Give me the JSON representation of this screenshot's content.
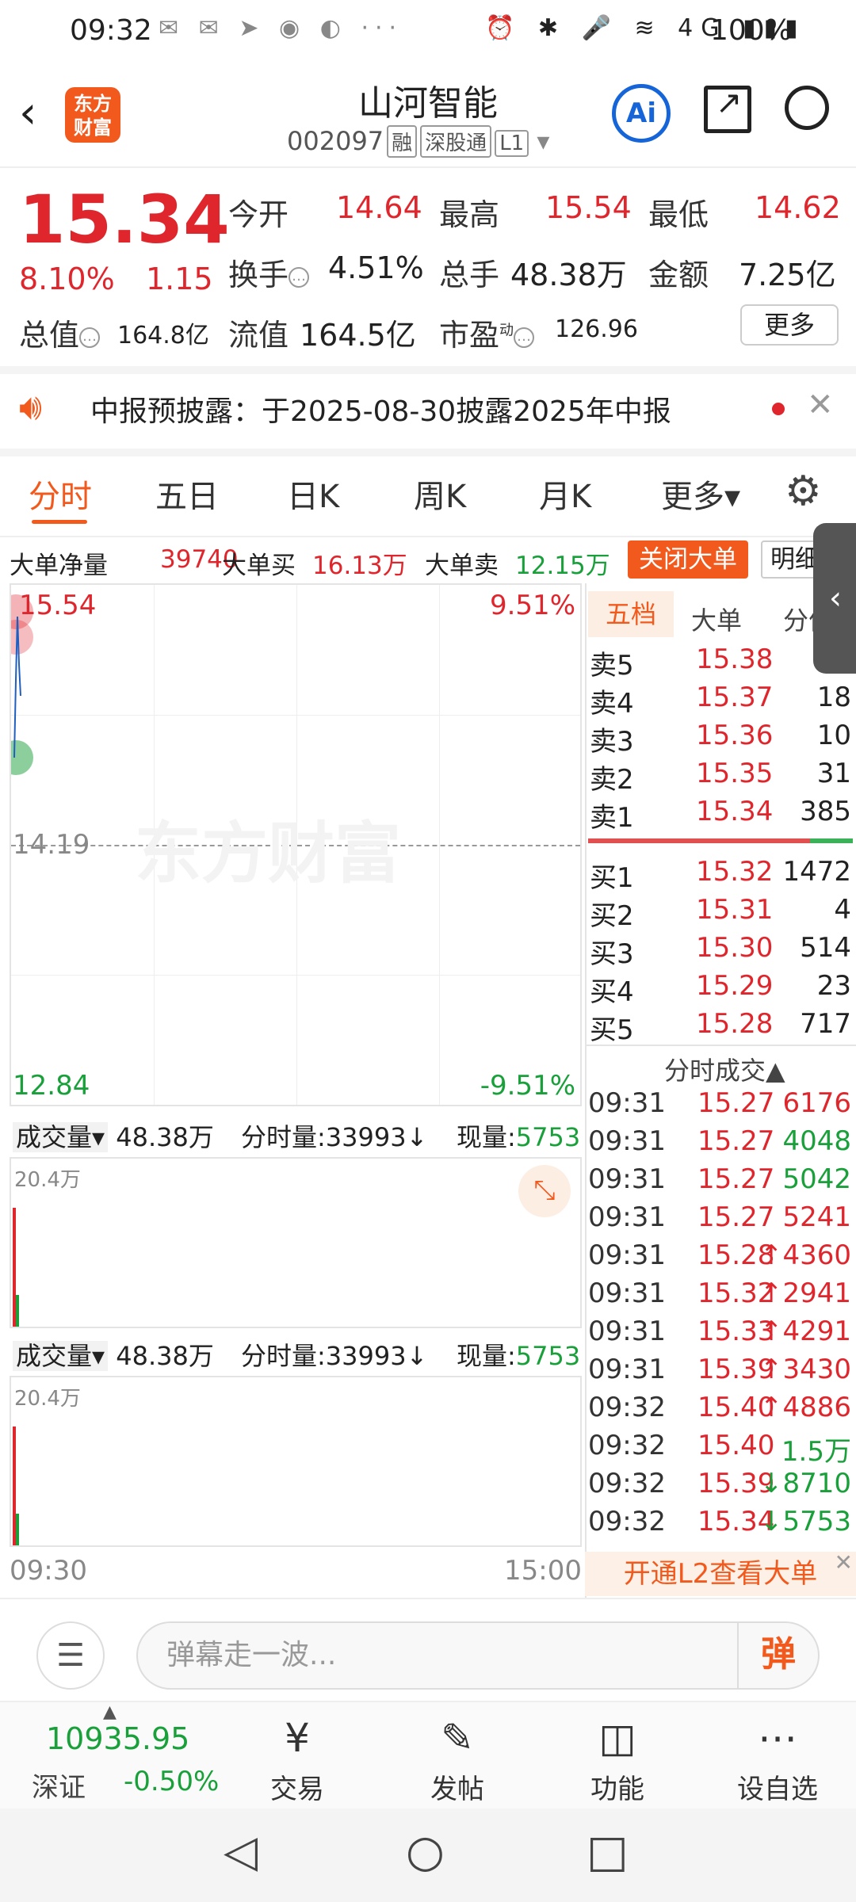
{
  "status_bar": {
    "time": "09:32",
    "left_icons": "✉ ✉ ➤ ◉ ◐ ···",
    "right_icons": "⏰ ✱ 🎤 ≋ 4G ▮▮▮",
    "battery": "100%"
  },
  "header": {
    "back_icon": "‹",
    "logo_text": "东方财富",
    "stock_name": "山河智能",
    "stock_code": "002097",
    "tags": [
      "融",
      "深股通",
      "L1"
    ],
    "ai_label": "Ai"
  },
  "quote": {
    "price": "15.34",
    "change_pct": "8.10%",
    "change": "1.15",
    "open_label": "今开",
    "open": "14.64",
    "high_label": "最高",
    "high": "15.54",
    "low_label": "最低",
    "low": "14.62",
    "turnover_label": "换手",
    "turnover": "4.51%",
    "volume_label": "总手",
    "volume": "48.38万",
    "amount_label": "金额",
    "amount": "7.25亿",
    "mktcap_label": "总值",
    "mktcap": "164.8亿",
    "float_label": "流值",
    "float": "164.5亿",
    "pe_label": "市盈",
    "pe_sup": "动",
    "pe": "126.96",
    "more_label": "更多"
  },
  "notice": {
    "text": "中报预披露：于2025-08-30披露2025年中报",
    "close_icon": "✕"
  },
  "tabs": [
    {
      "label": "分时",
      "active": true
    },
    {
      "label": "五日"
    },
    {
      "label": "日K"
    },
    {
      "label": "周K"
    },
    {
      "label": "月K"
    },
    {
      "label": "更多▾"
    }
  ],
  "big_order": {
    "net_label": "大单净量",
    "net": "39740",
    "buy_label": "大单买",
    "buy": "16.13万",
    "sell_label": "大单卖",
    "sell": "12.15万",
    "close_label": "关闭大单",
    "detail_label": "明细"
  },
  "chart": {
    "high_price": "15.54",
    "high_pct": "9.51%",
    "pre_close": "14.19",
    "low_price": "12.84",
    "low_pct": "-9.51%",
    "watermark": "东方财富",
    "time_start": "09:30",
    "time_end": "15:00"
  },
  "volume_panels": [
    {
      "label": "成交量",
      "total": "48.38万",
      "minute_label": "分时量:",
      "minute": "33993",
      "minute_arrow": "↓",
      "now_label": "现量:",
      "now": "5753",
      "max": "20.4万"
    },
    {
      "label": "成交量",
      "total": "48.38万",
      "minute_label": "分时量:",
      "minute": "33993",
      "minute_arrow": "↓",
      "now_label": "现量:",
      "now": "5753",
      "max": "20.4万"
    }
  ],
  "book": {
    "tabs": [
      "五档",
      "大单",
      "分价"
    ],
    "sells": [
      {
        "label": "卖5",
        "price": "15.38",
        "vol": ""
      },
      {
        "label": "卖4",
        "price": "15.37",
        "vol": "18"
      },
      {
        "label": "卖3",
        "price": "15.36",
        "vol": "10"
      },
      {
        "label": "卖2",
        "price": "15.35",
        "vol": "31"
      },
      {
        "label": "卖1",
        "price": "15.34",
        "vol": "385"
      }
    ],
    "buys": [
      {
        "label": "买1",
        "price": "15.32",
        "vol": "1472"
      },
      {
        "label": "买2",
        "price": "15.31",
        "vol": "4"
      },
      {
        "label": "买3",
        "price": "15.30",
        "vol": "514"
      },
      {
        "label": "买4",
        "price": "15.29",
        "vol": "23"
      },
      {
        "label": "买5",
        "price": "15.28",
        "vol": "717"
      }
    ],
    "trades_title": "分时成交▲",
    "trades": [
      {
        "time": "09:31",
        "price": "15.27",
        "vol": "6176",
        "color": "red"
      },
      {
        "time": "09:31",
        "price": "15.27",
        "vol": "4048",
        "color": "green"
      },
      {
        "time": "09:31",
        "price": "15.27",
        "vol": "5042",
        "color": "green"
      },
      {
        "time": "09:31",
        "price": "15.27",
        "vol": "5241",
        "color": "red"
      },
      {
        "time": "09:31",
        "price": "15.28",
        "vol": "↑4360",
        "color": "red"
      },
      {
        "time": "09:31",
        "price": "15.32",
        "vol": "↑2941",
        "color": "red"
      },
      {
        "time": "09:31",
        "price": "15.33",
        "vol": "↑4291",
        "color": "red"
      },
      {
        "time": "09:31",
        "price": "15.39",
        "vol": "↑3430",
        "color": "red"
      },
      {
        "time": "09:32",
        "price": "15.40",
        "vol": "↑4886",
        "color": "red"
      },
      {
        "time": "09:32",
        "price": "15.40",
        "vol": "1.5万",
        "color": "green"
      },
      {
        "time": "09:32",
        "price": "15.39",
        "vol": "↓8710",
        "color": "green"
      },
      {
        "time": "09:32",
        "price": "15.34",
        "vol": "↓5753",
        "color": "green"
      }
    ],
    "l2_banner": "开通L2查看大单"
  },
  "comment": {
    "placeholder": "弹幕走一波...",
    "send_label": "弹"
  },
  "bottom_nav": {
    "index_value": "10935.95",
    "index_name": "深证",
    "index_change": "-0.50%",
    "items": [
      {
        "label": "交易",
        "icon": "¥"
      },
      {
        "label": "发帖",
        "icon": "✎"
      },
      {
        "label": "功能",
        "icon": "◫"
      },
      {
        "label": "设自选",
        "icon": "⋯"
      }
    ]
  },
  "system_nav": {
    "back": "◁",
    "home": "○",
    "recent": "□"
  },
  "colors": {
    "up": "#e0262d",
    "down": "#19a03a",
    "brand": "#f25a1d"
  }
}
